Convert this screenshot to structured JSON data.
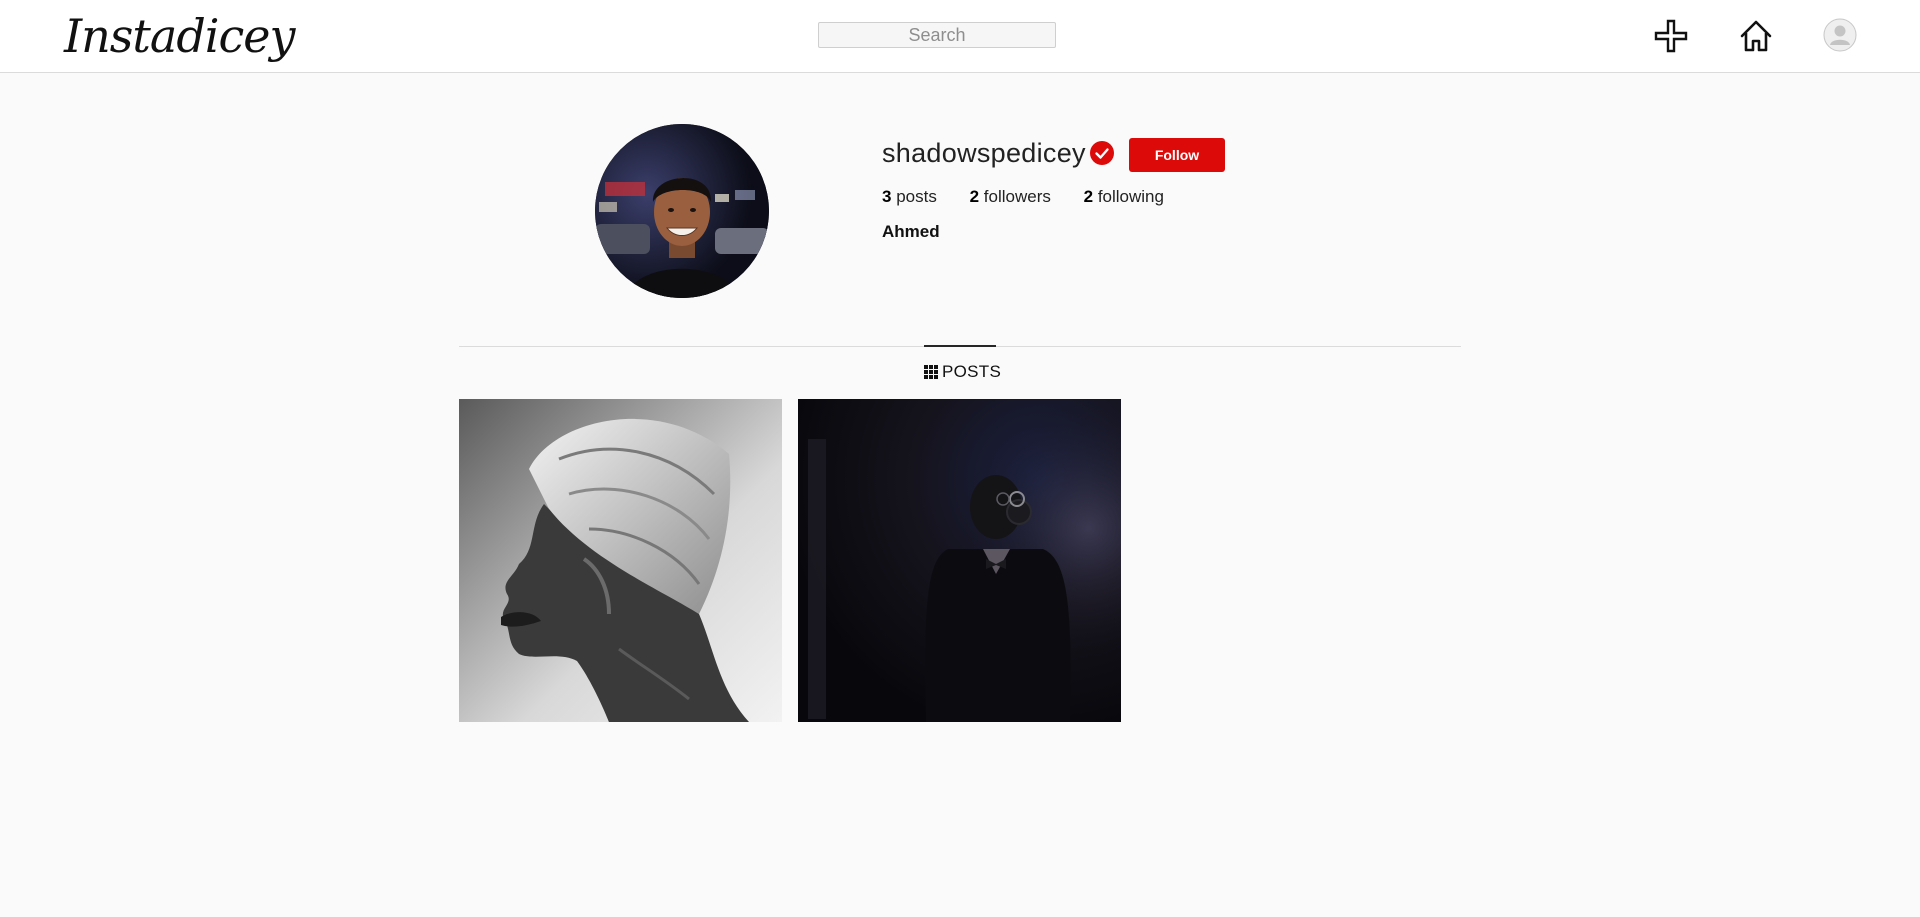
{
  "header": {
    "logo": "Instadicey",
    "search": {
      "placeholder": "Search",
      "value": ""
    },
    "icons": [
      "add-post-icon",
      "home-icon",
      "user-avatar-icon"
    ]
  },
  "profile": {
    "username": "shadowspedicey",
    "verified": true,
    "follow_label": "Follow",
    "stats": {
      "posts_count": "3",
      "posts_label": "posts",
      "followers_count": "2",
      "followers_label": "followers",
      "following_count": "2",
      "following_label": "following"
    },
    "full_name": "Ahmed"
  },
  "tabs": {
    "posts_label": "POSTS"
  },
  "colors": {
    "accent": "#dd0a0a",
    "background": "#fafafa",
    "header_bg": "#ffffff",
    "border": "#dbdbdb"
  }
}
